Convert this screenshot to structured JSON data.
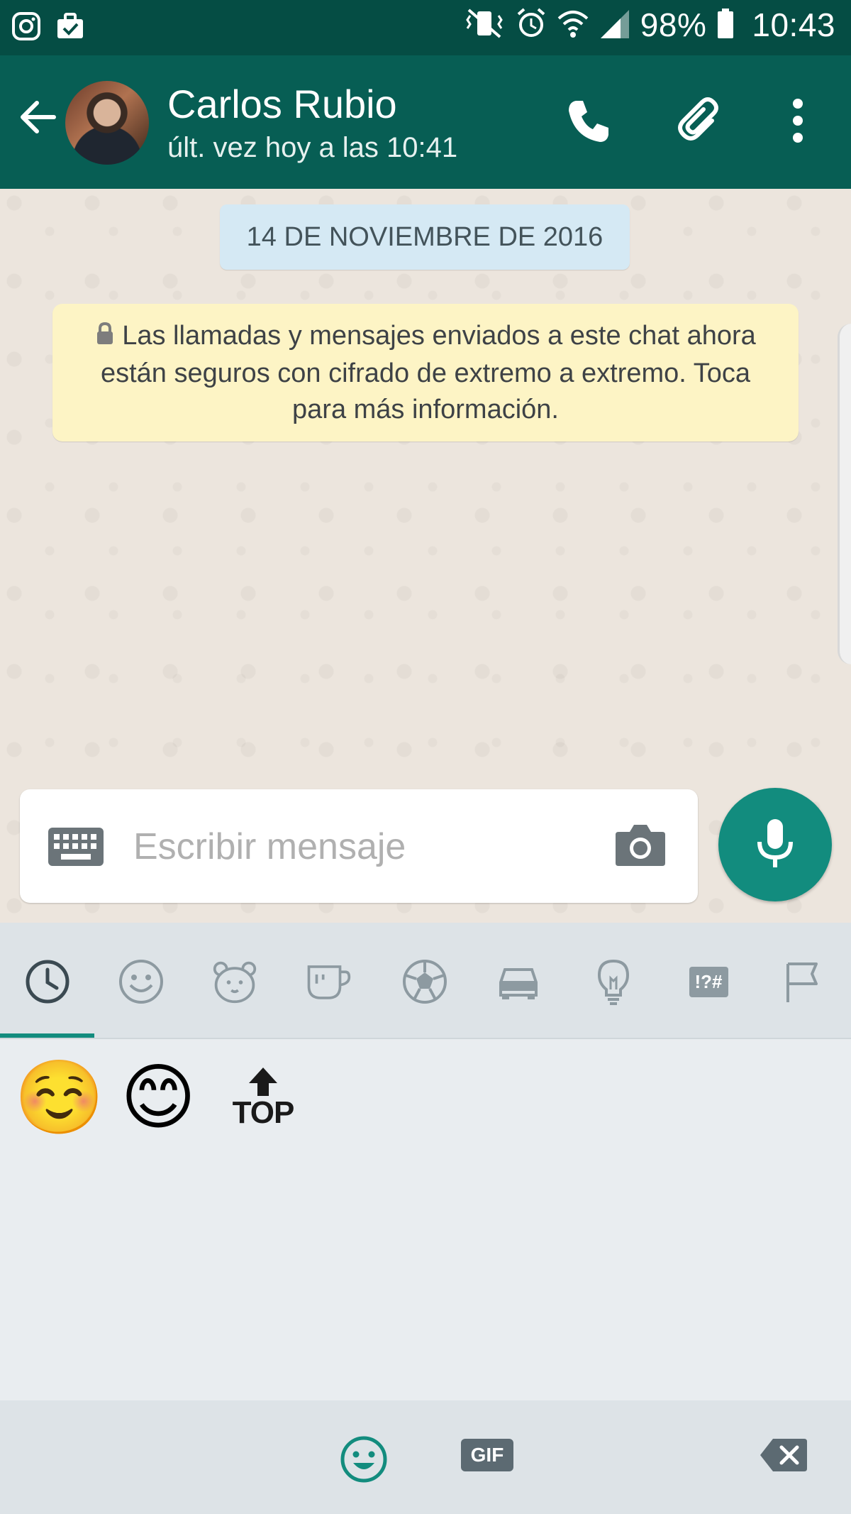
{
  "status_bar": {
    "battery": "98%",
    "time": "10:43",
    "left_icons": [
      "instagram-icon",
      "briefcase-check-icon"
    ],
    "right_icons": [
      "vibrate-mute-icon",
      "alarm-icon",
      "wifi-icon",
      "signal-icon",
      "battery-icon"
    ]
  },
  "header": {
    "contact_name": "Carlos Rubio",
    "last_seen": "últ. vez hoy a las 10:41",
    "actions": [
      "call-icon",
      "attach-icon",
      "more-vert-icon"
    ]
  },
  "chat": {
    "date_chip": "14 DE NOVIEMBRE DE 2016",
    "encryption_notice": "Las llamadas y mensajes enviados a este chat ahora están seguros con cifrado de extremo a extremo. Toca para más información."
  },
  "composer": {
    "placeholder": "Escribir mensaje",
    "value": ""
  },
  "emoji_keyboard": {
    "tabs": [
      "recent-tab",
      "smileys-tab",
      "animals-tab",
      "food-tab",
      "activity-tab",
      "travel-tab",
      "objects-tab",
      "symbols-tab",
      "flags-tab"
    ],
    "selected_tab": "recent-tab",
    "symbols_tab_label": "!?#",
    "recent": [
      "☺️",
      "😊"
    ],
    "top_emoji_label": "TOP",
    "gif_label": "GIF"
  },
  "colors": {
    "status_bar": "#054D44",
    "app_bar": "#075E54",
    "accent": "#128C7E",
    "date_chip": "#D5E9F4",
    "notice": "#FDF4C5"
  }
}
